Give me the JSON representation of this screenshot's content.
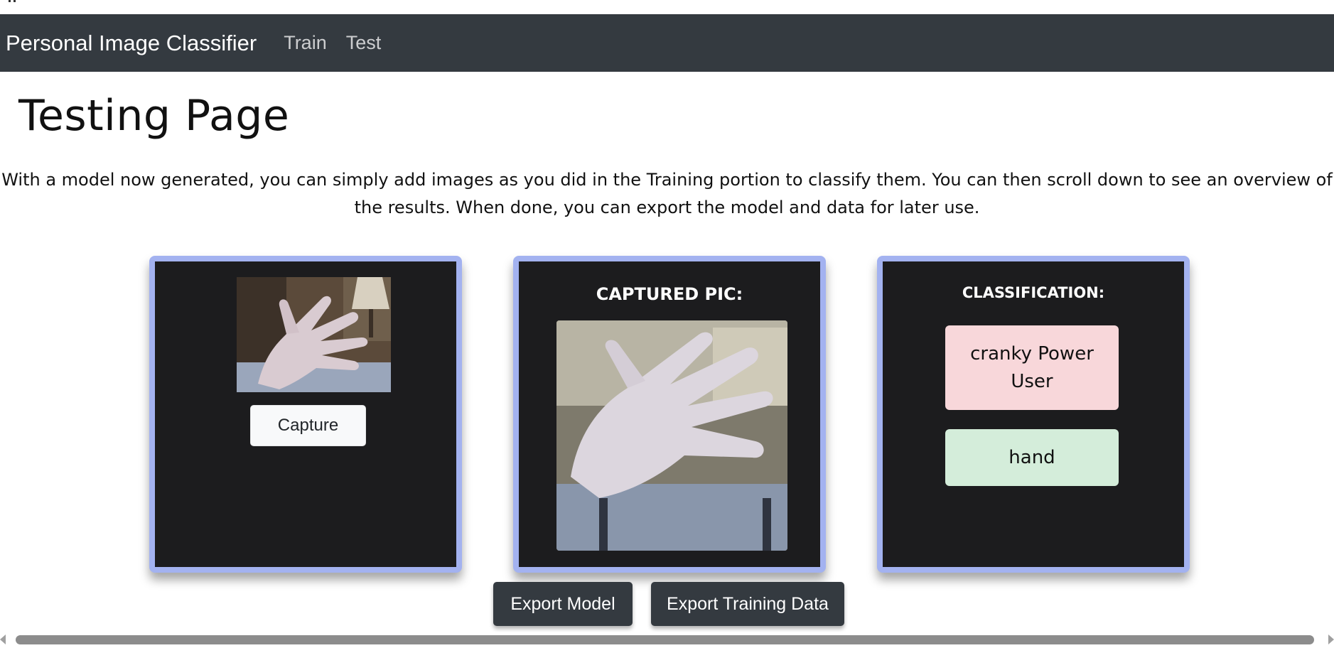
{
  "navbar": {
    "brand": "Personal Image Classifier",
    "links": [
      "Train",
      "Test"
    ]
  },
  "page": {
    "title": "Testing Page",
    "intro": "With a model now generated, you can simply add images as you did in the Training portion to classify them. You can then scroll down to see an overview of the results. When done, you can export the model and data for later use."
  },
  "webcam_panel": {
    "capture_label": "Capture"
  },
  "captured_panel": {
    "heading": "CAPTURED PIC:"
  },
  "classification_panel": {
    "heading": "CLASSIFICATION:",
    "labels": [
      "cranky Power User",
      "hand"
    ]
  },
  "actions": {
    "export_model": "Export Model",
    "export_training_data": "Export Training Data"
  },
  "colors": {
    "navbar_bg": "#343a40",
    "card_bg": "#1c1c1e",
    "card_border": "#a3b2f0",
    "label_pink": "#f8d7da",
    "label_green": "#d4edda"
  }
}
